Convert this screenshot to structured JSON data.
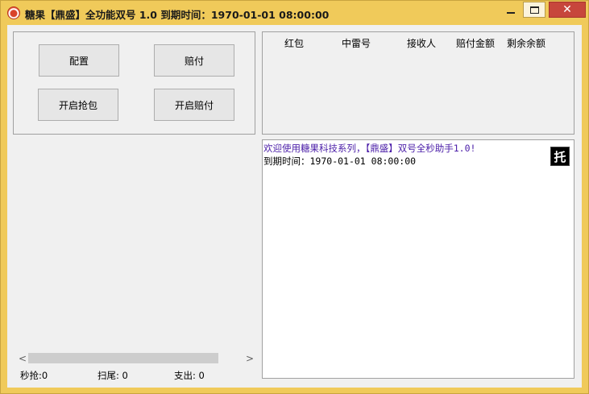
{
  "window": {
    "title": "糖果【鼎盛】全功能双号 1.0 到期时间：1970-01-01 08:00:00"
  },
  "buttons": {
    "config": "配置",
    "pay": "赔付",
    "start_grab": "开启抢包",
    "start_pay": "开启赔付"
  },
  "list": {
    "columns": [
      "红包",
      "中雷号",
      "接收人",
      "赔付金额",
      "剩余余额"
    ]
  },
  "log": {
    "lines": [
      "欢迎使用糖果科技系列，【鼎盛】双号全秒助手1.0!",
      "到期时间：1970-01-01 08:00:00"
    ],
    "badge": "托"
  },
  "scrollbar": {
    "left_arrow": "<",
    "right_arrow": ">"
  },
  "status": {
    "grab": "秒抢:0",
    "tail": "扫尾: 0",
    "expense": "支出: 0"
  }
}
